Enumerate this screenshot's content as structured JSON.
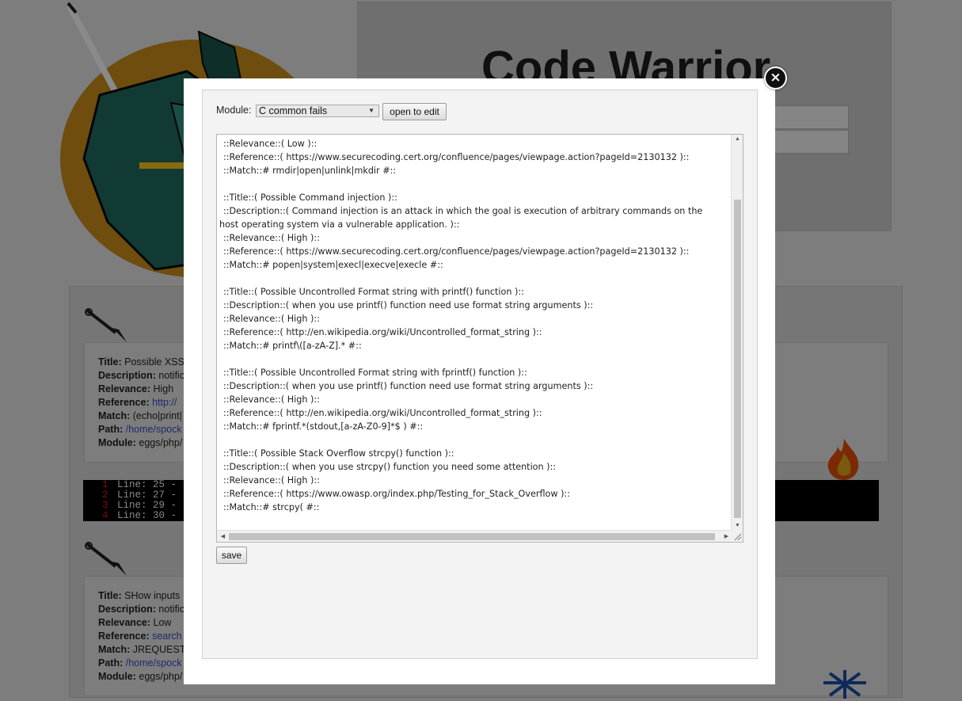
{
  "background": {
    "site_title": "Code Warrior",
    "cards": [
      {
        "title_label": "Title:",
        "title": "Possible XSS",
        "description_label": "Description:",
        "description": "notific",
        "relevance_label": "Relevance:",
        "relevance": "High",
        "reference_label": "Reference:",
        "reference": "http://",
        "match_label": "Match:",
        "match": "(echo|print|",
        "path_label": "Path:",
        "path": "/home/spock",
        "module_label": "Module:",
        "module": "eggs/php/"
      },
      {
        "title_label": "Title:",
        "title": "SHow inputs",
        "description_label": "Description:",
        "description": "notific",
        "relevance_label": "Relevance:",
        "relevance": "Low",
        "reference_label": "Reference:",
        "reference": "search",
        "match_label": "Match:",
        "match": "JREQUEST",
        "path_label": "Path:",
        "path": "/home/spock",
        "module_label": "Module:",
        "module": "eggs/php/"
      }
    ],
    "code_lines": [
      {
        "num": "1",
        "text": "Line: 25 -"
      },
      {
        "num": "2",
        "text": "Line: 27 -"
      },
      {
        "num": "3",
        "text": "Line: 29 -"
      },
      {
        "num": "4",
        "text": "Line: 30 -"
      }
    ]
  },
  "modal": {
    "close_symbol": "×",
    "module_label": "Module:",
    "module_selected": "C common fails",
    "select_caret": "▼",
    "open_button": "open to edit",
    "save_button": "save",
    "editor_lines": [
      "::Relevance::( Low )::",
      "::Reference::( https://www.securecoding.cert.org/confluence/pages/viewpage.action?pageId=2130132 )::",
      "::Match::# rmdir|open|unlink|mkdir #::",
      "",
      "::Title::( Possible Command injection )::",
      "::Description::( Command injection is an attack in which the goal is execution of arbitrary commands on the",
      "host operating system via a vulnerable application. )::",
      "::Relevance::( High )::",
      "::Reference::( https://www.securecoding.cert.org/confluence/pages/viewpage.action?pageId=2130132 )::",
      "::Match::# popen|system|execl|execve|execle #::",
      "",
      "::Title::( Possible Uncontrolled Format string with printf() function )::",
      "::Description::( when you use printf() function need use format string arguments )::",
      "::Relevance::( High )::",
      "::Reference::( http://en.wikipedia.org/wiki/Uncontrolled_format_string )::",
      "::Match::# printf\\([a-zA-Z].* #::",
      "",
      "::Title::( Possible Uncontrolled Format string with fprintf() function )::",
      "::Description::( when you use printf() function need use format string arguments )::",
      "::Relevance::( High )::",
      "::Reference::( http://en.wikipedia.org/wiki/Uncontrolled_format_string )::",
      "::Match::# fprintf.*(stdout,[a-zA-Z0-9]*$ ) #::",
      "",
      "::Title::( Possible Stack Overflow strcpy() function )::",
      "::Description::( when you use strcpy() function you need some attention )::",
      "::Relevance::( High )::",
      "::Reference::( https://www.owasp.org/index.php/Testing_for_Stack_Overflow )::",
      "::Match::# strcpy( #::"
    ],
    "continuation_line_index": 6
  },
  "colors": {
    "overlay": "#7d7d7d",
    "modal_bg": "#ffffff",
    "panel_bg": "#f3f3f3",
    "code_line_number": "#7a1010",
    "link": "#1d2a6e"
  }
}
